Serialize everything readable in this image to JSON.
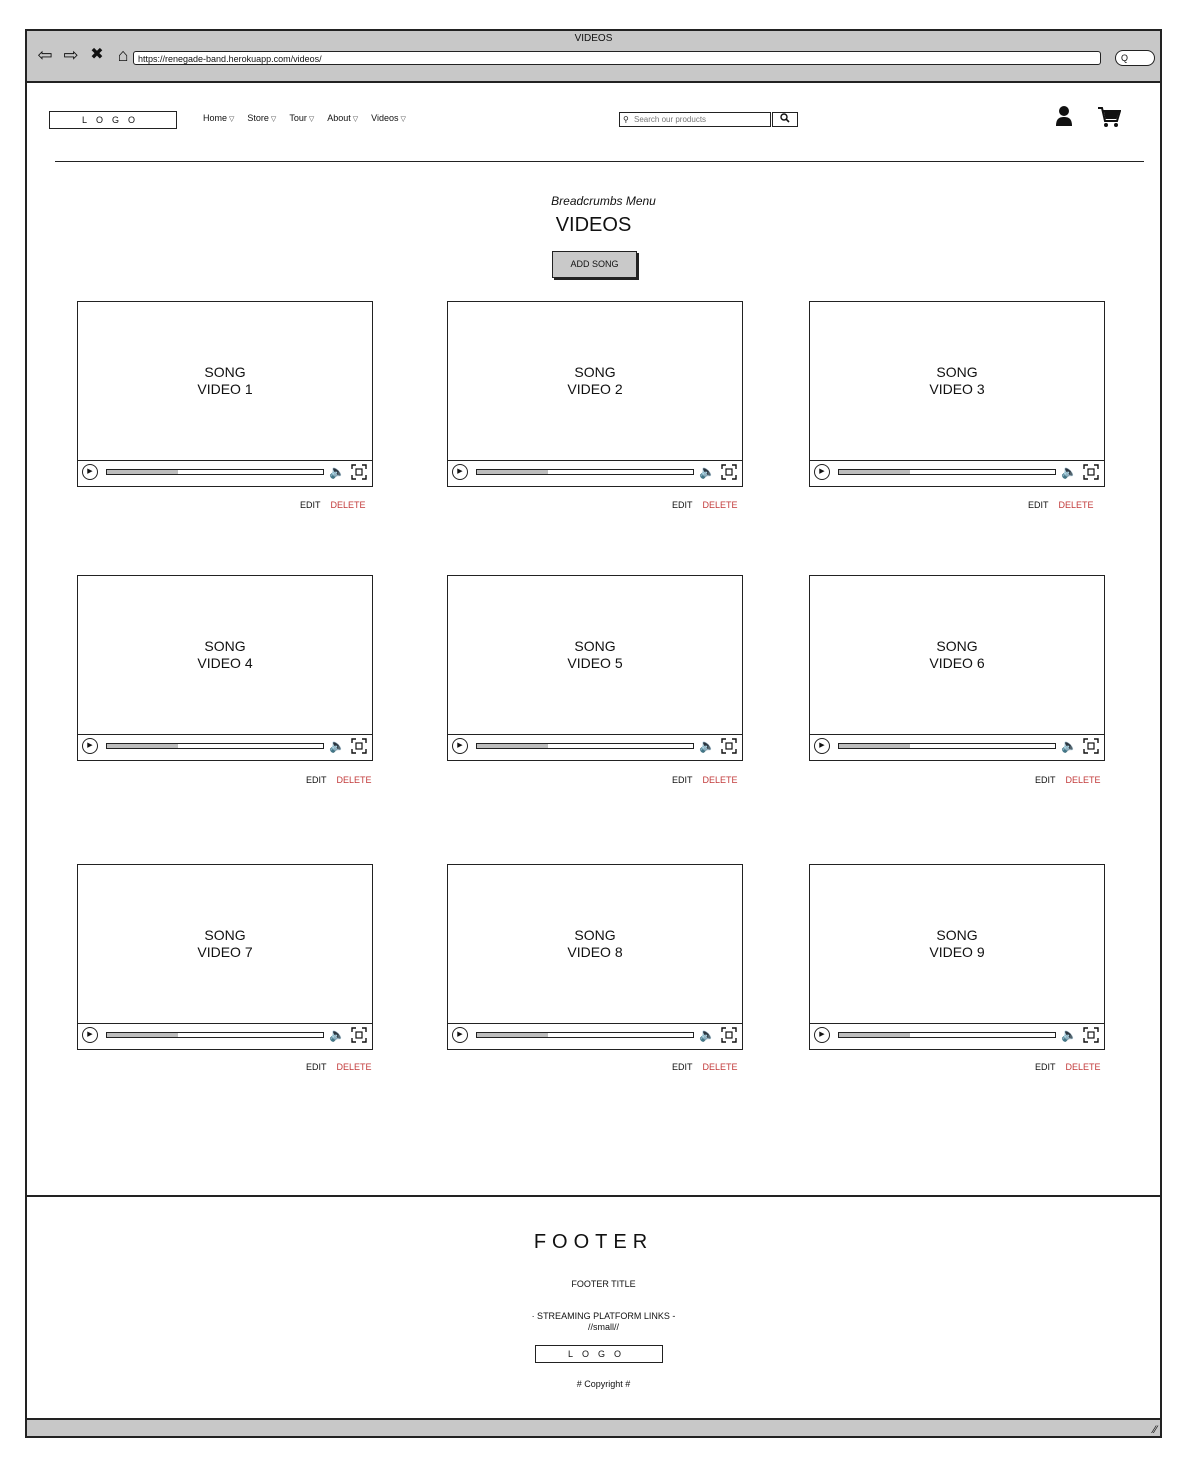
{
  "browser": {
    "title": "VIDEOS",
    "url": "https://renegade-band.herokuapp.com/videos/",
    "search_glyph": "Q"
  },
  "header": {
    "logo": "LOGO",
    "menu": [
      {
        "label": "Home"
      },
      {
        "label": "Store"
      },
      {
        "label": "Tour"
      },
      {
        "label": "About"
      },
      {
        "label": "Videos"
      }
    ],
    "search_placeholder": "Search our products"
  },
  "page": {
    "breadcrumbs": "Breadcrumbs Menu",
    "title": "VIDEOS",
    "add_button": "ADD SONG"
  },
  "videos": [
    {
      "line1": "SONG",
      "line2": "VIDEO 1",
      "progress": 0.33,
      "edit": "EDIT",
      "delete": "DELETE"
    },
    {
      "line1": "SONG",
      "line2": "VIDEO 2",
      "progress": 0.33,
      "edit": "EDIT",
      "delete": "DELETE"
    },
    {
      "line1": "SONG",
      "line2": "VIDEO 3",
      "progress": 0.33,
      "edit": "EDIT",
      "delete": "DELETE"
    },
    {
      "line1": "SONG",
      "line2": "VIDEO 4",
      "progress": 0.33,
      "edit": "EDIT",
      "delete": "DELETE"
    },
    {
      "line1": "SONG",
      "line2": "VIDEO 5",
      "progress": 0.33,
      "edit": "EDIT",
      "delete": "DELETE"
    },
    {
      "line1": "SONG",
      "line2": "VIDEO 6",
      "progress": 0.33,
      "edit": "EDIT",
      "delete": "DELETE"
    },
    {
      "line1": "SONG",
      "line2": "VIDEO 7",
      "progress": 0.33,
      "edit": "EDIT",
      "delete": "DELETE"
    },
    {
      "line1": "SONG",
      "line2": "VIDEO 8",
      "progress": 0.33,
      "edit": "EDIT",
      "delete": "DELETE"
    },
    {
      "line1": "SONG",
      "line2": "VIDEO 9",
      "progress": 0.33,
      "edit": "EDIT",
      "delete": "DELETE"
    }
  ],
  "footer": {
    "title": "FOOTER",
    "subtitle": "FOOTER TITLE",
    "links_line1": "·  STREAMING PLATFORM LINKS -",
    "links_line2": "//small//",
    "logo": "LOGO",
    "copyright": "# Copyright #"
  },
  "colors": {
    "chrome": "#c8c8c8",
    "delete": "#c23a3a",
    "button": "#c9c9c9"
  }
}
